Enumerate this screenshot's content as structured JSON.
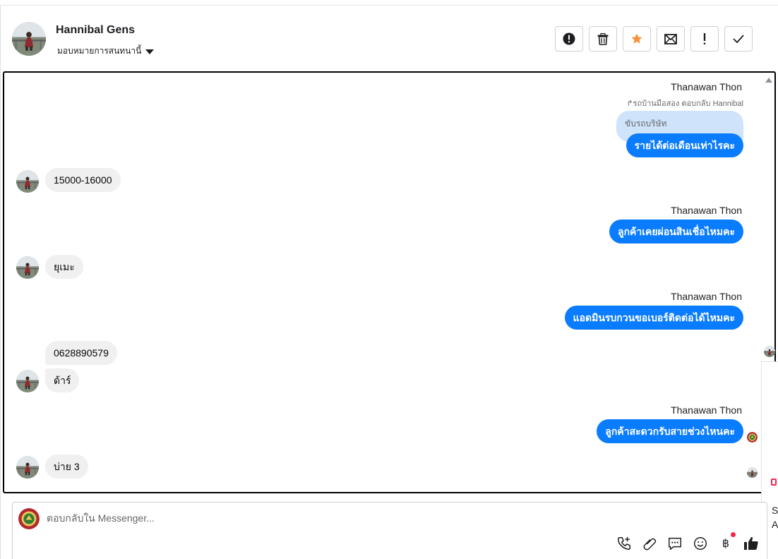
{
  "header": {
    "contact_name": "Hannibal Gens",
    "assign_label": "มอบหมายการสนทนานี้",
    "actions": [
      {
        "name": "spam-button",
        "icon": "alert-circle-icon"
      },
      {
        "name": "delete-button",
        "icon": "trash-icon"
      },
      {
        "name": "star-button",
        "icon": "star-icon",
        "color": "#f7923b"
      },
      {
        "name": "mark-unread-button",
        "icon": "envelope-icon"
      },
      {
        "name": "follow-up-button",
        "icon": "exclamation-icon"
      },
      {
        "name": "mark-done-button",
        "icon": "checkmark-icon"
      }
    ]
  },
  "thread": {
    "messages": [
      {
        "direction": "out",
        "sender": "Thanawan Thon",
        "reply_meta": "รถบ้านมือสอง ตอบกลับ Hannibal",
        "quoted": "ขับรถบริษัท",
        "text": "รายได้ต่อเดือนเท่าไรคะ"
      },
      {
        "direction": "in",
        "text": "15000-16000"
      },
      {
        "direction": "out",
        "sender": "Thanawan Thon",
        "text": "ลูกค้าเคยผ่อนสินเชื่อไหมคะ"
      },
      {
        "direction": "in",
        "text": "ยุเมะ"
      },
      {
        "direction": "out",
        "sender": "Thanawan Thon",
        "text": "แอดมินรบกวนขอเบอร์ติดต่อได้ไหมคะ"
      },
      {
        "direction": "in",
        "text": "0628890579"
      },
      {
        "direction": "in",
        "text": "ด้าร์"
      },
      {
        "direction": "out",
        "sender": "Thanawan Thon",
        "text": "ลูกค้าสะดวกรับสายช่วงไหนคะ"
      },
      {
        "direction": "in",
        "text": "บ่าย 3"
      }
    ]
  },
  "edge_panel": {
    "text_1": "S",
    "text_2": "A"
  },
  "composer": {
    "placeholder": "ตอบกลับใน Messenger...",
    "tools": [
      "call-add-icon",
      "paperclip-icon",
      "saved-reply-icon",
      "emoji-icon",
      "baht-icon",
      "thumbs-up-icon"
    ],
    "baht_symbol": "฿"
  },
  "colors": {
    "outgoing_bubble": "#0a7cff",
    "incoming_bubble": "#f0f0f0",
    "quoted_bubble": "#cfe3fb",
    "star": "#f7923b",
    "notification_dot": "#f02849"
  }
}
